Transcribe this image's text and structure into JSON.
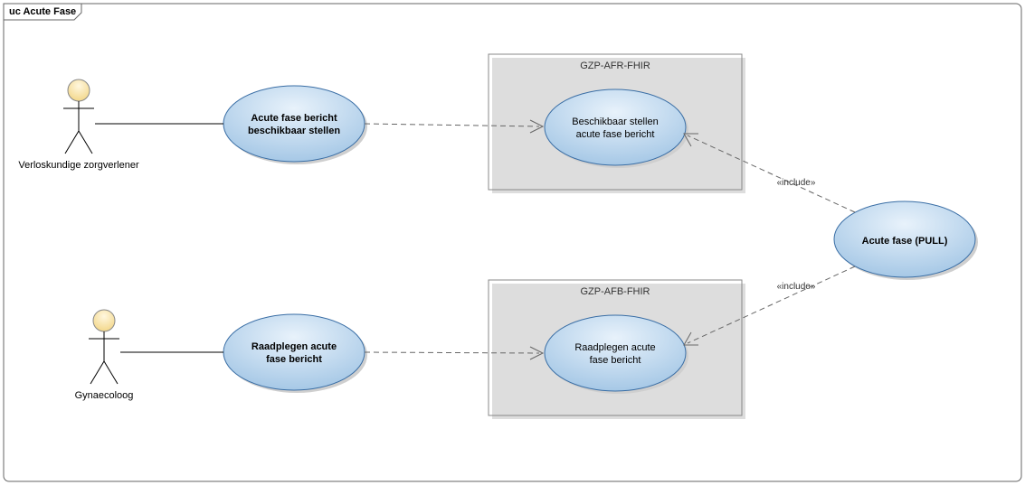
{
  "frame": {
    "title": "uc Acute Fase"
  },
  "actors": {
    "a1": {
      "label": "Verloskundige zorgverlener"
    },
    "a2": {
      "label": "Gynaecoloog"
    }
  },
  "usecases": {
    "uc1": {
      "label_l1": "Acute fase bericht",
      "label_l2": "beschikbaar stellen"
    },
    "uc2": {
      "label_l1": "Beschikbaar stellen",
      "label_l2": "acute fase bericht"
    },
    "uc3": {
      "label_l1": "Raadplegen acute",
      "label_l2": "fase bericht"
    },
    "uc4": {
      "label_l1": "Raadplegen acute",
      "label_l2": "fase bericht"
    },
    "uc5": {
      "label_l1": "Acute fase (PULL)"
    }
  },
  "boundaries": {
    "b1": {
      "label": "GZP-AFR-FHIR"
    },
    "b2": {
      "label": "GZP-AFB-FHIR"
    }
  },
  "stereotypes": {
    "include": "«include»"
  },
  "colors": {
    "ellipseTop": "#d6e8f7",
    "ellipseBottom": "#a6c8e6",
    "headTop": "#fff3cf",
    "headBottom": "#f3d78a"
  }
}
